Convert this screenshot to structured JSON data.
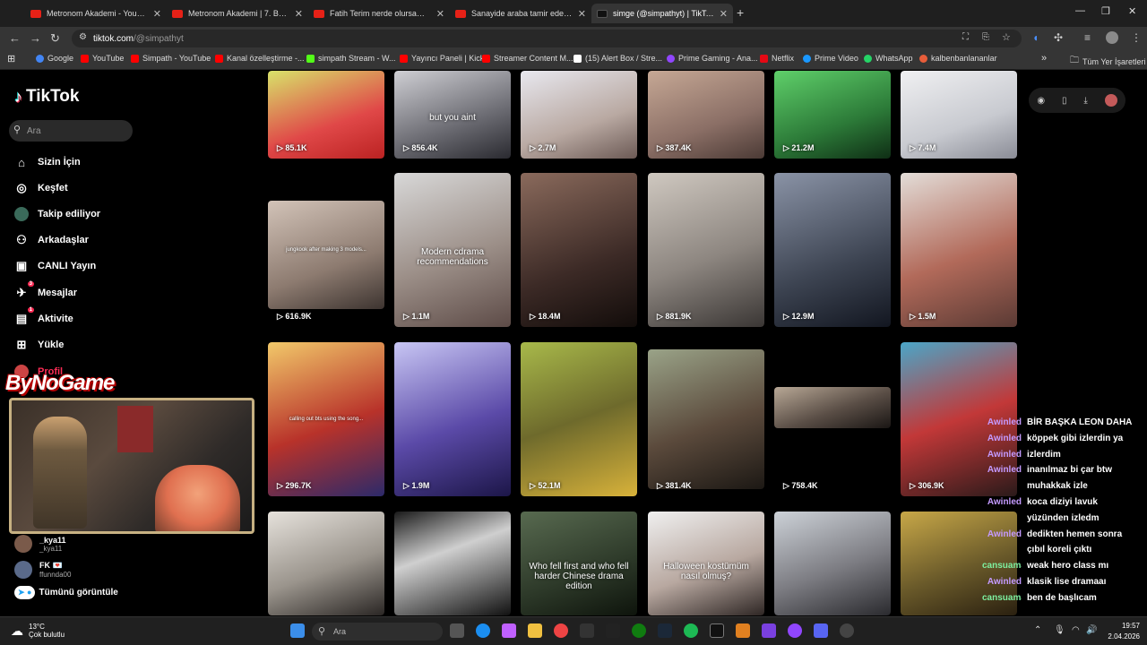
{
  "browser": {
    "tabs": [
      {
        "label": "Metronom Akademi - YouTube",
        "icon": "youtube-icon"
      },
      {
        "label": "Metronom Akademi | 7. Bölüm",
        "icon": "youtube-icon"
      },
      {
        "label": "Fatih Terim nerde olursam olay",
        "icon": "youtube-icon"
      },
      {
        "label": "Sanayide araba tamir eden usta",
        "icon": "youtube-icon"
      },
      {
        "label": "simge (@simpathyt) | TikTok",
        "icon": "tiktok-icon"
      }
    ],
    "new_tab": "+",
    "url_domain": "tiktok.com",
    "url_path": "/@simpathyt",
    "bookmarks": [
      {
        "label": "Google",
        "color": "#4285f4"
      },
      {
        "label": "YouTube",
        "color": "#ff0000"
      },
      {
        "label": "Simpath - YouTube",
        "color": "#ff0000"
      },
      {
        "label": "Kanal özelleştirme -...",
        "color": "#ff0000"
      },
      {
        "label": "simpath Stream - W...",
        "color": "#53fc18"
      },
      {
        "label": "Yayıncı Paneli | Kick",
        "color": "#ff0000"
      },
      {
        "label": "Streamer Content M...",
        "color": "#ff0000"
      },
      {
        "label": "(15) Alert Box / Stre...",
        "color": "#ffffff"
      },
      {
        "label": "Prime Gaming - Ana...",
        "color": "#9146ff"
      },
      {
        "label": "Netflix",
        "color": "#e50914"
      },
      {
        "label": "Prime Video",
        "color": "#1a98ff"
      },
      {
        "label": "WhatsApp",
        "color": "#25d366"
      },
      {
        "label": "kalbenbanlananlar",
        "color": "#e85d3a"
      }
    ],
    "all_bookmarks": "Tüm Yer İşaretleri",
    "more_bookmarks": "»"
  },
  "tiktok": {
    "logo": "TikTok",
    "search_placeholder": "Ara",
    "nav": [
      {
        "label": "Sizin İçin",
        "icon": "home-icon",
        "glyph": "⌂"
      },
      {
        "label": "Keşfet",
        "icon": "compass-icon",
        "glyph": "◎"
      },
      {
        "label": "Takip ediliyor",
        "icon": "following-avatar-icon",
        "glyph": "●"
      },
      {
        "label": "Arkadaşlar",
        "icon": "friends-icon",
        "glyph": "⚇"
      },
      {
        "label": "CANLI Yayın",
        "icon": "live-tv-icon",
        "glyph": "▣"
      },
      {
        "label": "Mesajlar",
        "icon": "paper-plane-icon",
        "glyph": "✈",
        "badge": "3"
      },
      {
        "label": "Aktivite",
        "icon": "activity-icon",
        "glyph": "▤",
        "badge": "1"
      },
      {
        "label": "Yükle",
        "icon": "upload-plus-icon",
        "glyph": "⊞"
      },
      {
        "label": "Profil",
        "icon": "profile-icon",
        "glyph": "●"
      }
    ],
    "following": [
      {
        "name": "_kya11",
        "handle": "_kya11"
      },
      {
        "name": "FK 💌",
        "handle": "ffunnda00"
      }
    ],
    "see_all": "Tümünü görüntüle",
    "videos": [
      {
        "views": "85.1K",
        "bg": "linear-gradient(160deg,#d8e36a,#e04848 60%,#b22)",
        "caption": ""
      },
      {
        "views": "856.4K",
        "bg": "linear-gradient(160deg,#cfcfd4,#6b6b72 60%,#2a2a30)",
        "caption": "but you aint"
      },
      {
        "views": "2.7M",
        "bg": "linear-gradient(160deg,#e8e8ef,#b9a9a2 60%,#6c5a55)",
        "caption": ""
      },
      {
        "views": "387.4K",
        "bg": "linear-gradient(160deg,#c6a895,#8b6f66 60%,#4b3a35)",
        "caption": ""
      },
      {
        "views": "21.2M",
        "bg": "linear-gradient(160deg,#5fd06a,#2c7a38 60%,#0f2e15)",
        "caption": ""
      },
      {
        "views": "7.4M",
        "bg": "linear-gradient(160deg,#f0f0f2,#c8cad0 60%,#8a8c96)",
        "caption": ""
      },
      {
        "views": "616.9K",
        "bg": "linear-gradient(160deg,#d2c3b8,#8d7b70 60%,#3d3430)",
        "caption": "jungkook after making 3 models..."
      },
      {
        "views": "1.1M",
        "bg": "linear-gradient(160deg,#d8d8d8,#9c8f88 55%,#5d4b47)",
        "caption": "Modern cdrama recommendations"
      },
      {
        "views": "18.4M",
        "bg": "linear-gradient(160deg,#8a6a5c,#3c2a26 60%,#120c0a)",
        "caption": ""
      },
      {
        "views": "881.9K",
        "bg": "linear-gradient(160deg,#cfc8c0,#8d8680 55%,#3a3634)",
        "caption": ""
      },
      {
        "views": "12.9M",
        "bg": "linear-gradient(160deg,#8a93a6,#3d4452 60%,#121620)",
        "caption": ""
      },
      {
        "views": "1.5M",
        "bg": "linear-gradient(160deg,#e3ddd8,#b26a5a 55%,#5a3a34)",
        "caption": ""
      },
      {
        "views": "296.7K",
        "bg": "linear-gradient(160deg,#f2c96a,#b8322a 55%,#2c2a6a)",
        "caption": "calling out bts using the song..."
      },
      {
        "views": "1.9M",
        "bg": "linear-gradient(160deg,#c8c6f4,#5b4aa8 55%,#1c1648)",
        "caption": ""
      },
      {
        "views": "52.1M",
        "bg": "linear-gradient(160deg,#a8b94a,#6e6a2c 50%,#d8b23a)",
        "caption": ""
      },
      {
        "views": "381.4K",
        "bg": "linear-gradient(160deg,#9aa388,#5b4a3c 55%,#1c1814)",
        "caption": ""
      },
      {
        "views": "758.4K",
        "bg": "linear-gradient(160deg,#b8a896,#5a4e46 55%,#1a1614)",
        "caption": ""
      },
      {
        "views": "306.9K",
        "bg": "linear-gradient(160deg,#4aa6c8,#c23838 50%,#2a1a1a)",
        "caption": ""
      },
      {
        "views": "",
        "bg": "linear-gradient(160deg,#e6e2dc,#9a948c 55%,#2a2624)",
        "caption": ""
      },
      {
        "views": "",
        "bg": "linear-gradient(160deg,#1a1a1a,#cfcfcf 40%,#111)",
        "caption": ""
      },
      {
        "views": "",
        "bg": "linear-gradient(160deg,#586a50,#2c3828 60%,#0e140c)",
        "caption": "Who fell first and who fell harder Chinese drama edition"
      },
      {
        "views": "",
        "bg": "linear-gradient(160deg,#f0f0f0,#b8a8a0 55%,#2e2624)",
        "caption": "Halloween kostümüm nasıl olmuş?"
      },
      {
        "views": "",
        "bg": "linear-gradient(160deg,#cdd2d8,#7c7c82 55%,#2a2a2e)",
        "caption": ""
      },
      {
        "views": "",
        "bg": "linear-gradient(160deg,#c8a848,#6a5a2a 55%,#2a2010)",
        "caption": ""
      }
    ]
  },
  "stream": {
    "brand": "ByNoGame",
    "chat": [
      {
        "user": "Awinled",
        "msg": "BİR BAŞKA LEON DAHA",
        "color": "#c49aff"
      },
      {
        "user": "Awinled",
        "msg": "köppek gibi izlerdin ya",
        "color": "#c49aff"
      },
      {
        "user": "Awinled",
        "msg": "izlerdim",
        "color": "#c49aff"
      },
      {
        "user": "Awinled",
        "msg": "inanılmaz bi çar btw",
        "color": "#c49aff"
      },
      {
        "user": "",
        "msg": "muhakkak izle",
        "color": "#c49aff"
      },
      {
        "user": "Awinled",
        "msg": "koca diziyi lavuk",
        "color": "#c49aff"
      },
      {
        "user": "",
        "msg": "yüzünden izledm",
        "color": "#c49aff"
      },
      {
        "user": "Awinled",
        "msg": "dedikten hemen sonra",
        "color": "#c49aff"
      },
      {
        "user": "",
        "msg": "çıbıl koreli çıktı",
        "color": "#c49aff"
      },
      {
        "user": "cansuamahan...",
        "msg": "weak hero class mı",
        "color": "#7ef0a0"
      },
      {
        "user": "Awinled",
        "msg": "klasik lise dramaaı",
        "color": "#c49aff"
      },
      {
        "user": "cansuamahan...",
        "msg": "ben de başlıcam",
        "color": "#7ef0a0"
      }
    ]
  },
  "taskbar": {
    "temperature": "13°C",
    "weather": "Çok bulutlu",
    "search_placeholder": "Ara",
    "time": "19:57",
    "date": "2.04.2026"
  }
}
